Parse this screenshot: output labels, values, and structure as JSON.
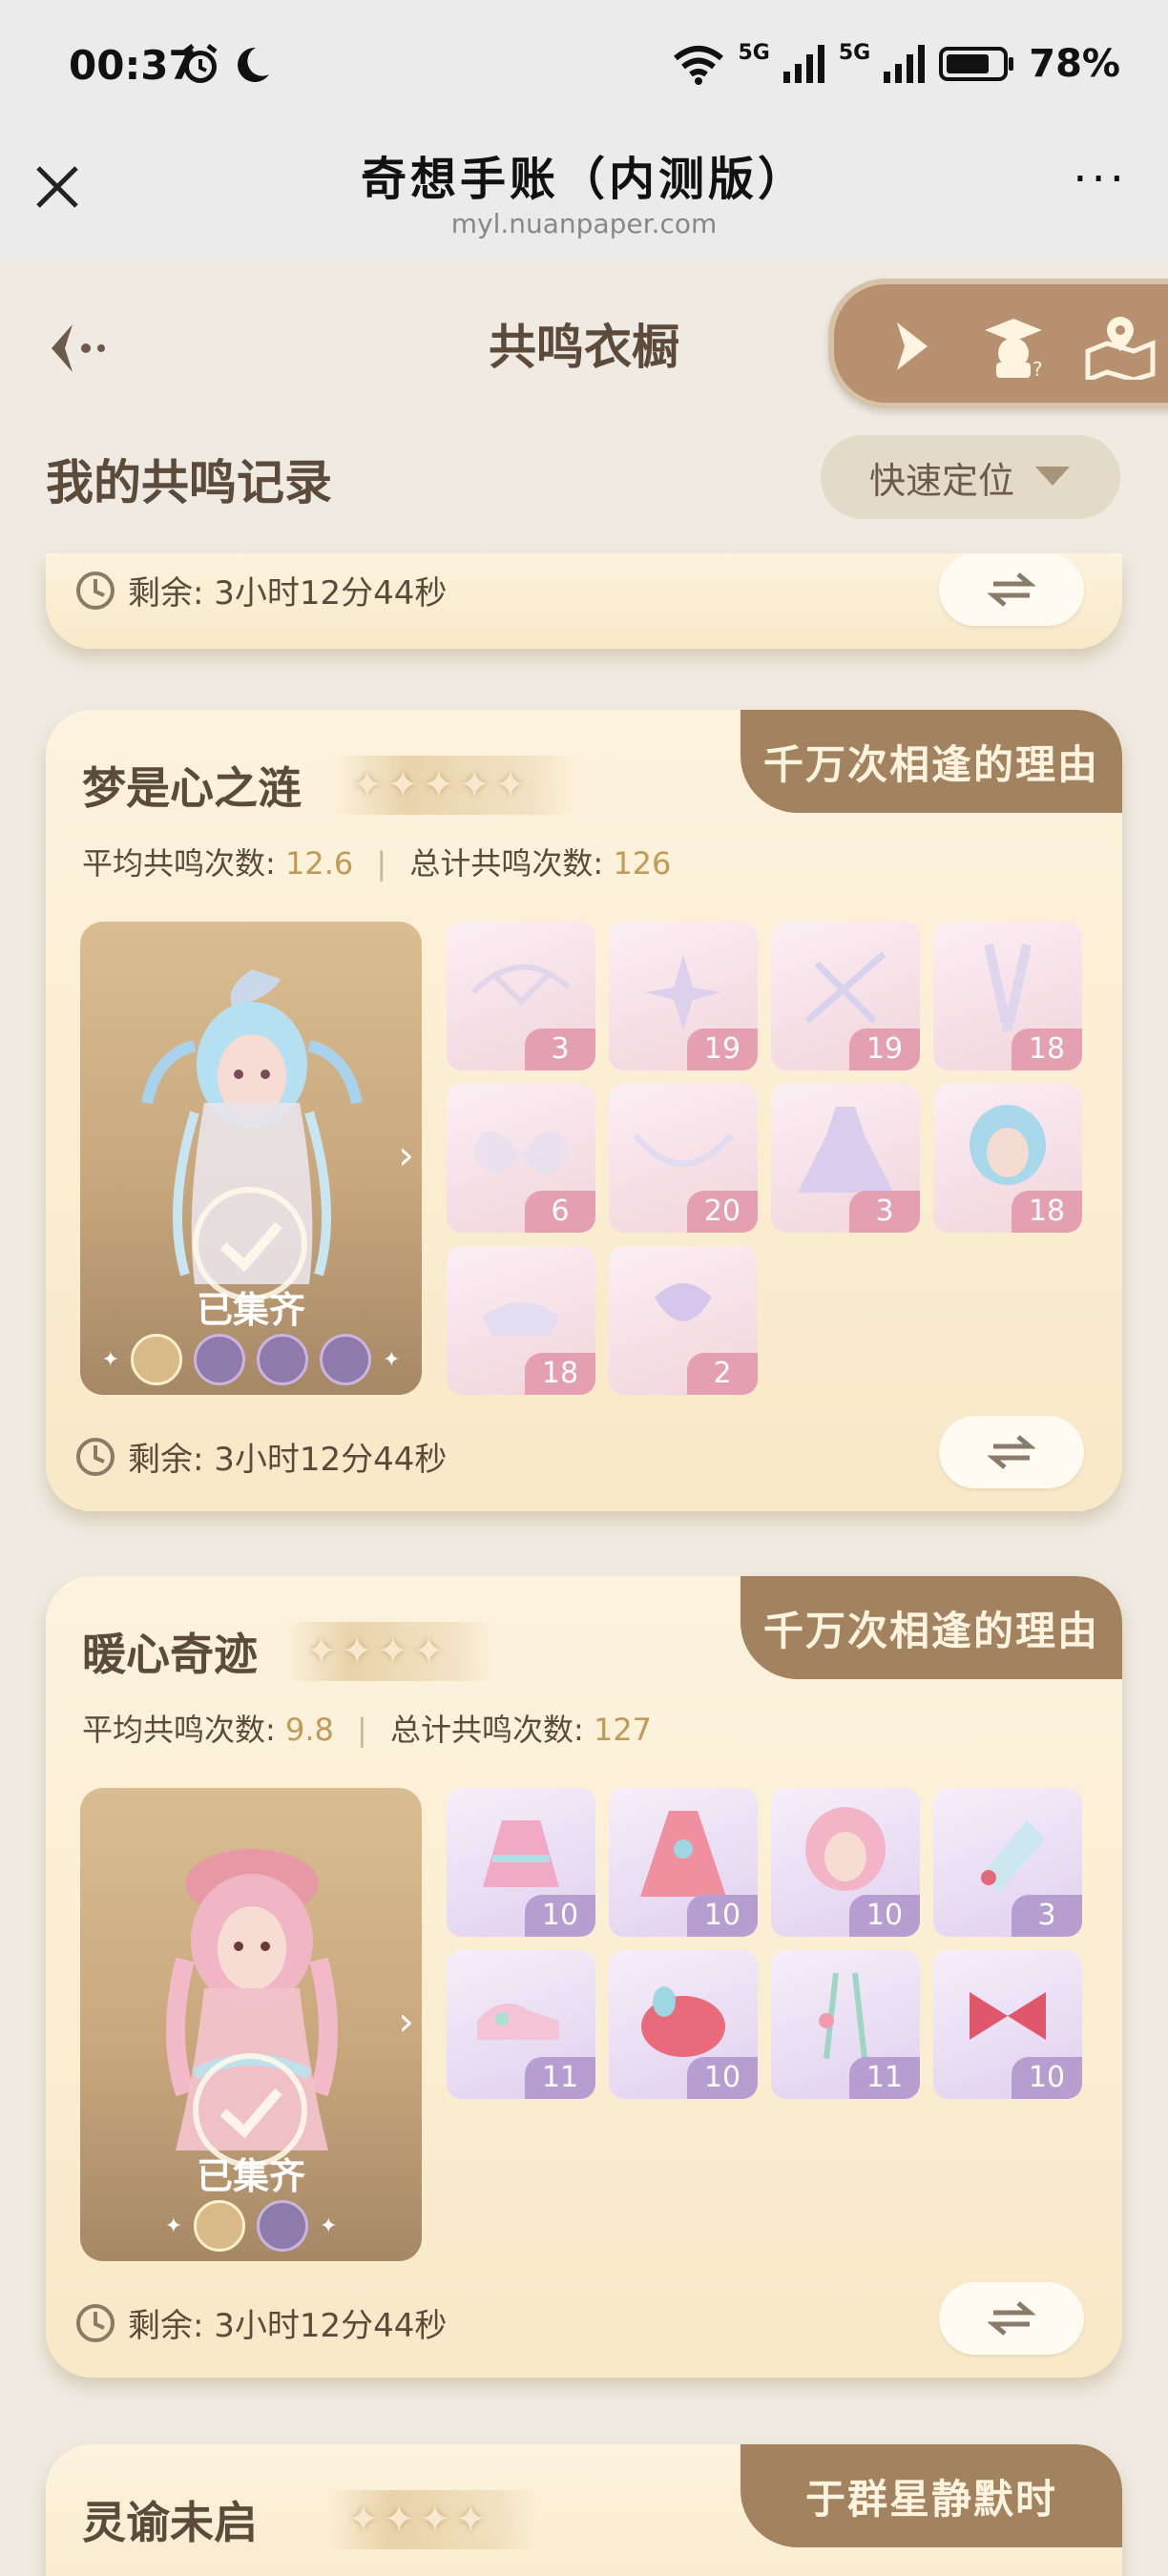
{
  "status_bar": {
    "time": "00:37",
    "network1": "5G",
    "network2": "5G",
    "battery": "78%"
  },
  "webview": {
    "title": "奇想手账（内测版）",
    "url": "myl.nuanpaper.com",
    "more": "···"
  },
  "header": {
    "title": "共鸣衣橱",
    "section_title": "我的共鸣记录",
    "quick_locate": "快速定位"
  },
  "card0": {
    "remain": "剩余: 3小时12分44秒"
  },
  "card1": {
    "name": "梦是心之涟",
    "tag": "千万次相逢的理由",
    "stars": "✦✦✦✦✦",
    "avg_label": "平均共鸣次数:",
    "avg_value": "12.6",
    "sep": "|",
    "total_label": "总计共鸣次数:",
    "total_value": "126",
    "collected": "已集齐",
    "items": [
      "3",
      "19",
      "19",
      "18",
      "6",
      "20",
      "3",
      "18",
      "18",
      "2"
    ],
    "remain": "剩余: 3小时12分44秒"
  },
  "card2": {
    "name": "暖心奇迹",
    "tag": "千万次相逢的理由",
    "stars": "✦✦✦✦",
    "avg_label": "平均共鸣次数:",
    "avg_value": "9.8",
    "sep": "|",
    "total_label": "总计共鸣次数:",
    "total_value": "127",
    "collected": "已集齐",
    "items": [
      "10",
      "10",
      "10",
      "3",
      "11",
      "10",
      "11",
      "10"
    ],
    "remain": "剩余: 3小时12分44秒"
  },
  "card3": {
    "name": "灵谕未启",
    "tag": "于群星静默时",
    "stars": "✦✦✦✦"
  },
  "colors": {
    "accent": "#a3825f",
    "pink_badge": "#e4a0b0",
    "purple_badge": "#b69fd0",
    "number_gold": "#c19a55"
  },
  "icons": [
    "alarm-icon",
    "moon-icon",
    "wifi-icon",
    "signal-icon",
    "battery-icon",
    "close-icon",
    "more-icon",
    "back-icon",
    "play-icon",
    "guide-icon",
    "map-icon",
    "chevron-down-icon",
    "clock-icon",
    "swap-icon",
    "check-icon"
  ]
}
